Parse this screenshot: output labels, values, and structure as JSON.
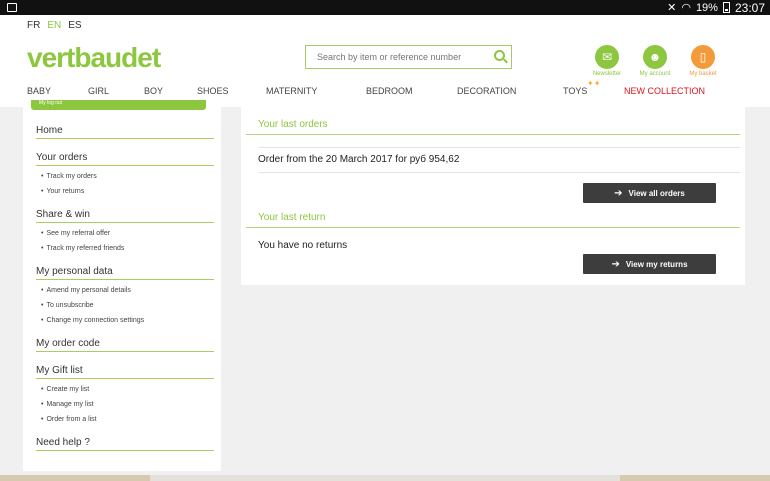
{
  "status_bar": {
    "battery": "19%",
    "time": "23:07"
  },
  "languages": [
    {
      "label": "FR",
      "active": false
    },
    {
      "label": "EN",
      "active": true
    },
    {
      "label": "ES",
      "active": false
    }
  ],
  "logo": "vertbaudet",
  "search": {
    "placeholder": "Search by item or reference number"
  },
  "account_links": {
    "newsletter": "Newsletter",
    "my_account": "My account",
    "my_basket": "My basket"
  },
  "nav": {
    "baby": "BABY",
    "girl": "GIRL",
    "boy": "BOY",
    "shoes": "SHOES",
    "maternity": "MATERNITY",
    "bedroom": "BEDROOM",
    "decoration": "DECORATION",
    "toys": "TOYS",
    "new_collection": "NEW COLLECTION"
  },
  "sidebar": {
    "tab_label": "My log out",
    "home": "Home",
    "your_orders": {
      "title": "Your orders",
      "items": [
        "Track my orders",
        "Your returns"
      ]
    },
    "share_win": {
      "title": "Share & win",
      "items": [
        "See my referral offer",
        "Track my referred friends"
      ]
    },
    "personal_data": {
      "title": "My personal data",
      "items": [
        "Amend my personal details",
        "To unsubscribe",
        "Change my connection settings"
      ]
    },
    "order_code": "My order code",
    "gift_list": {
      "title": "My Gift list",
      "items": [
        "Create my list",
        "Manage my list",
        "Order from a list"
      ]
    },
    "need_help": "Need help ?"
  },
  "main": {
    "last_orders_title": "Your last orders",
    "order_line": "Order from the 20 March 2017 for руб 954,62",
    "view_all_orders": "View all orders",
    "last_return_title": "Your last return",
    "no_returns": "You have no returns",
    "view_my_returns": "View my returns"
  },
  "colors": {
    "brand_green": "#8dc63f",
    "basket_orange": "#f39a3a",
    "new_collection_red": "#d9161e",
    "button_dark": "#3d3d3d"
  }
}
